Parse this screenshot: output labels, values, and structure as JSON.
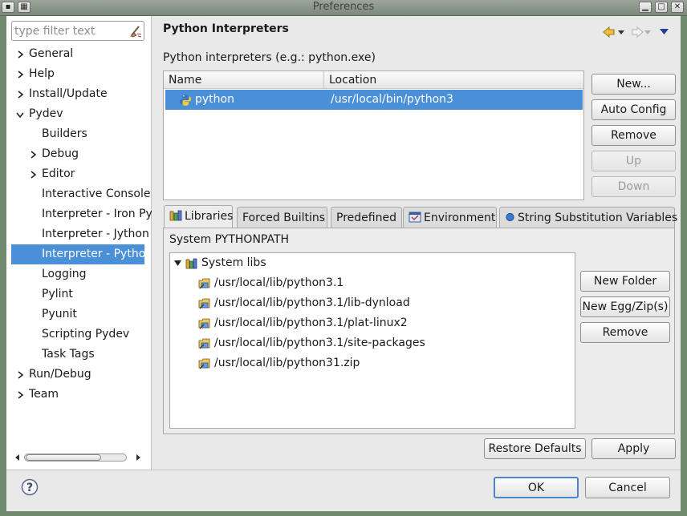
{
  "window": {
    "title": "Preferences"
  },
  "filter": {
    "placeholder": "type filter text"
  },
  "tree": {
    "items": [
      {
        "label": "General",
        "expandable": true,
        "expanded": false,
        "level": 0
      },
      {
        "label": "Help",
        "expandable": true,
        "expanded": false,
        "level": 0
      },
      {
        "label": "Install/Update",
        "expandable": true,
        "expanded": false,
        "level": 0
      },
      {
        "label": "Pydev",
        "expandable": true,
        "expanded": true,
        "level": 0
      },
      {
        "label": "Builders",
        "expandable": false,
        "level": 1
      },
      {
        "label": "Debug",
        "expandable": true,
        "expanded": false,
        "level": 1
      },
      {
        "label": "Editor",
        "expandable": true,
        "expanded": false,
        "level": 1
      },
      {
        "label": "Interactive Console",
        "expandable": false,
        "level": 1
      },
      {
        "label": "Interpreter - Iron Python",
        "expandable": false,
        "level": 1
      },
      {
        "label": "Interpreter - Jython",
        "expandable": false,
        "level": 1
      },
      {
        "label": "Interpreter - Python",
        "expandable": false,
        "level": 1,
        "selected": true
      },
      {
        "label": "Logging",
        "expandable": false,
        "level": 1
      },
      {
        "label": "Pylint",
        "expandable": false,
        "level": 1
      },
      {
        "label": "Pyunit",
        "expandable": false,
        "level": 1
      },
      {
        "label": "Scripting Pydev",
        "expandable": false,
        "level": 1
      },
      {
        "label": "Task Tags",
        "expandable": false,
        "level": 1
      },
      {
        "label": "Run/Debug",
        "expandable": true,
        "expanded": false,
        "level": 0
      },
      {
        "label": "Team",
        "expandable": true,
        "expanded": false,
        "level": 0
      }
    ]
  },
  "page": {
    "title": "Python Interpreters",
    "section_label": "Python interpreters (e.g.: python.exe)"
  },
  "interpreters": {
    "columns": [
      "Name",
      "Location"
    ],
    "rows": [
      {
        "name": "python",
        "location": "/usr/local/bin/python3"
      }
    ]
  },
  "interpreter_buttons": {
    "new": "New...",
    "auto_config": "Auto Config",
    "remove": "Remove",
    "up": "Up",
    "down": "Down"
  },
  "tabs": [
    "Libraries",
    "Forced Builtins",
    "Predefined",
    "Environment",
    "String Substitution Variables"
  ],
  "libraries": {
    "label": "System PYTHONPATH",
    "root": "System libs",
    "paths": [
      "/usr/local/lib/python3.1",
      "/usr/local/lib/python3.1/lib-dynload",
      "/usr/local/lib/python3.1/plat-linux2",
      "/usr/local/lib/python3.1/site-packages",
      "/usr/local/lib/python31.zip"
    ]
  },
  "library_buttons": {
    "new_folder": "New Folder",
    "new_egg": "New Egg/Zip(s)",
    "remove": "Remove"
  },
  "page_buttons": {
    "restore_defaults": "Restore Defaults",
    "apply": "Apply"
  },
  "dialog_buttons": {
    "ok": "OK",
    "cancel": "Cancel"
  },
  "colors": {
    "selection": "#4a90d9",
    "accent": "#4a86c8"
  }
}
